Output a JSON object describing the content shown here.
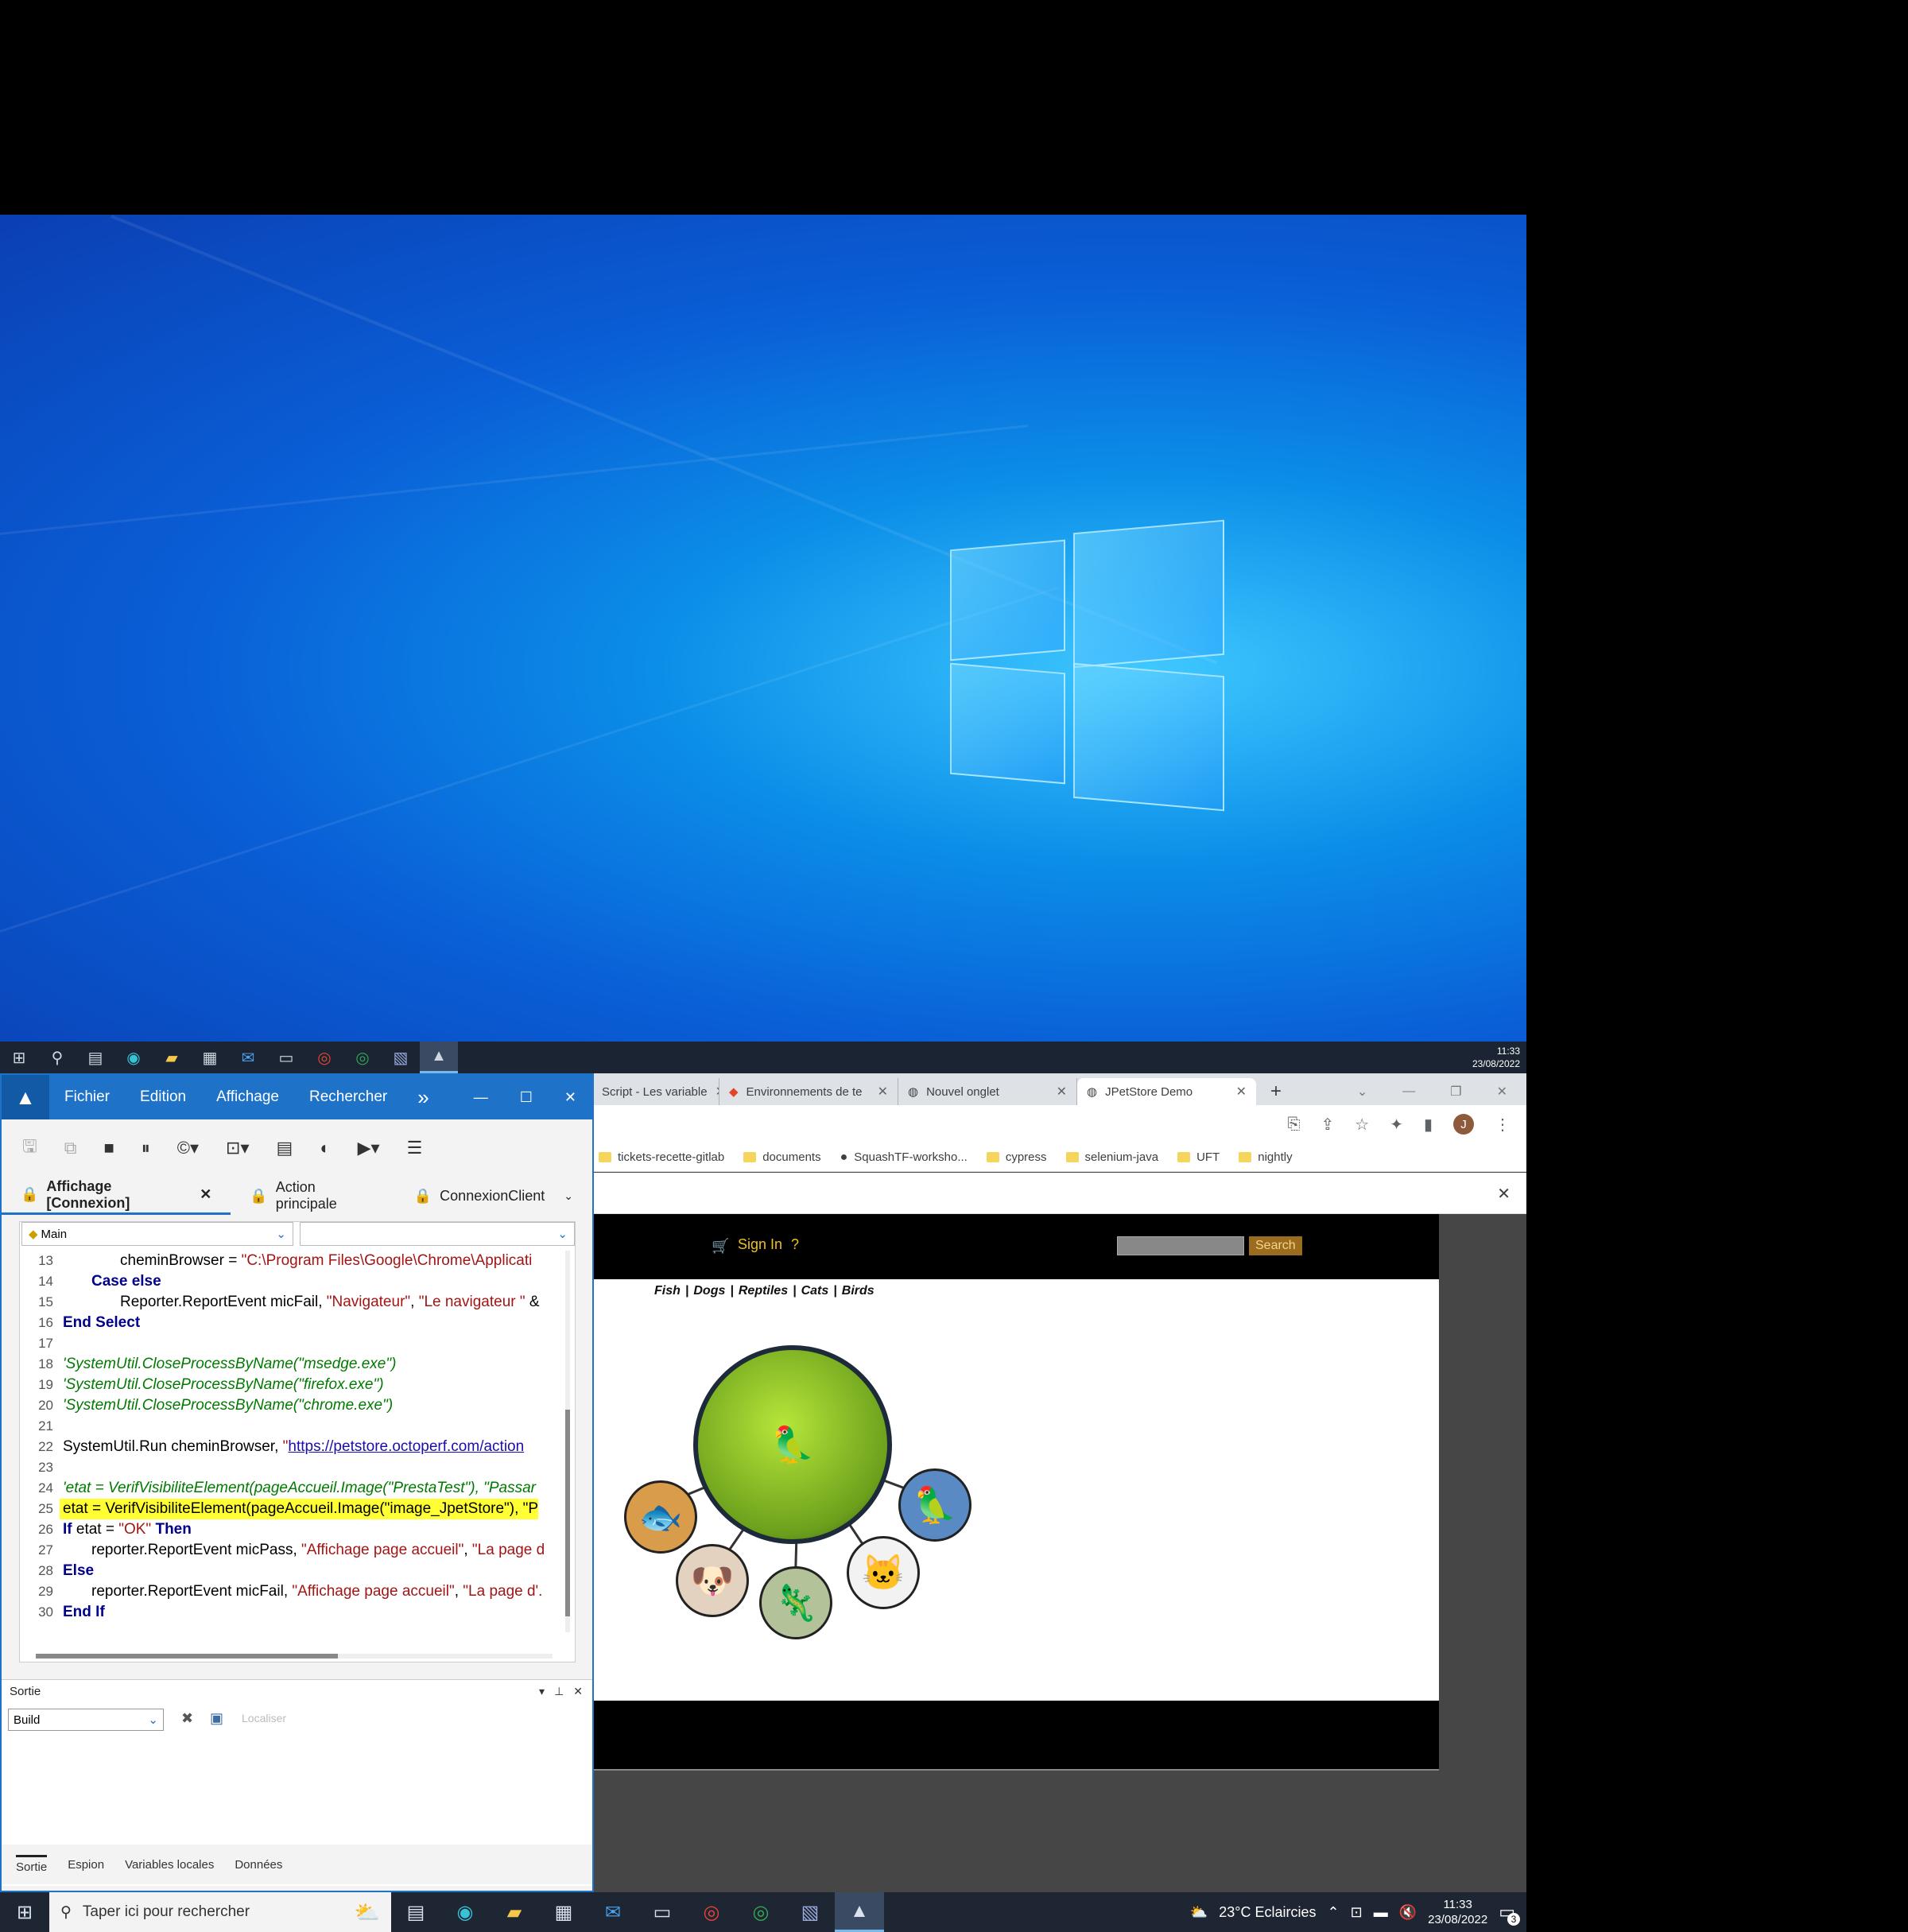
{
  "taskbar_top": {
    "time": "11:33",
    "date": "23/08/2022",
    "icons": [
      "windows-start-icon",
      "search-icon",
      "task-view-icon",
      "edge-icon",
      "explorer-icon",
      "store-icon",
      "mail-icon",
      "terminal-icon",
      "chrome-icon",
      "chrome-icon",
      "notepad-icon",
      "uft-icon"
    ]
  },
  "chrome": {
    "tabs": [
      {
        "label": "Script - Les variable",
        "active": false
      },
      {
        "label": "Environnements de te",
        "active": false
      },
      {
        "label": "Nouvel onglet",
        "active": false
      },
      {
        "label": "JPetStore Demo",
        "active": true
      }
    ],
    "new_tab": "+",
    "profile_initial": "J",
    "bookmarks": [
      "tickets-recette-gitlab",
      "documents",
      "SquashTF-worksho...",
      "cypress",
      "selenium-java",
      "UFT",
      "nightly"
    ],
    "infobar_close": "✕",
    "page": {
      "sign_in": "Sign In",
      "help": "?",
      "search_button": "Search",
      "categories": [
        "Fish",
        "Dogs",
        "Reptiles",
        "Cats",
        "Birds"
      ]
    }
  },
  "uft": {
    "menus": [
      "Fichier",
      "Edition",
      "Affichage",
      "Rechercher"
    ],
    "more": "»",
    "tabs": [
      {
        "label": "Affichage [Connexion]",
        "active": true,
        "closable": true
      },
      {
        "label": "Action principale",
        "active": false
      },
      {
        "label": "ConnexionClient",
        "active": false
      }
    ],
    "scope_combo": "Main",
    "code_lines": [
      {
        "n": "13",
        "indent": 2,
        "parts": [
          [
            "t",
            "cheminBrowser = "
          ],
          [
            "s",
            "\"C:\\Program Files\\Google\\Chrome\\Applicati"
          ]
        ]
      },
      {
        "n": "14",
        "indent": 1,
        "parts": [
          [
            "k",
            "Case else"
          ]
        ]
      },
      {
        "n": "15",
        "indent": 2,
        "parts": [
          [
            "t",
            "Reporter.ReportEvent micFail, "
          ],
          [
            "s",
            "\"Navigateur\""
          ],
          [
            "t",
            ", "
          ],
          [
            "s",
            "\"Le navigateur \""
          ],
          [
            "t",
            " &"
          ]
        ]
      },
      {
        "n": "16",
        "indent": 0,
        "parts": [
          [
            "k",
            "End Select"
          ]
        ]
      },
      {
        "n": "17",
        "indent": 0,
        "parts": []
      },
      {
        "n": "18",
        "indent": 0,
        "parts": [
          [
            "c",
            "'SystemUtil.CloseProcessByName(\"msedge.exe\")"
          ]
        ]
      },
      {
        "n": "19",
        "indent": 0,
        "parts": [
          [
            "c",
            "'SystemUtil.CloseProcessByName(\"firefox.exe\")"
          ]
        ]
      },
      {
        "n": "20",
        "indent": 0,
        "parts": [
          [
            "c",
            "'SystemUtil.CloseProcessByName(\"chrome.exe\")"
          ]
        ]
      },
      {
        "n": "21",
        "indent": 0,
        "parts": []
      },
      {
        "n": "22",
        "indent": 0,
        "parts": [
          [
            "t",
            "SystemUtil.Run cheminBrowser, "
          ],
          [
            "s",
            "\""
          ],
          [
            "u",
            "https://petstore.octoperf.com/action"
          ]
        ]
      },
      {
        "n": "23",
        "indent": 0,
        "parts": []
      },
      {
        "n": "24",
        "indent": 0,
        "parts": [
          [
            "c",
            "'etat = VerifVisibiliteElement(pageAccueil.Image(\"PrestaTest\"), \"Passar"
          ]
        ]
      },
      {
        "n": "25",
        "indent": 0,
        "hl": true,
        "parts": [
          [
            "t",
            "etat = VerifVisibiliteElement(pageAccueil.Image(\"image_JpetStore\"), \"P"
          ]
        ]
      },
      {
        "n": "26",
        "indent": 0,
        "parts": [
          [
            "k",
            "If"
          ],
          [
            "t",
            " etat = "
          ],
          [
            "s",
            "\"OK\""
          ],
          [
            "t",
            " "
          ],
          [
            "k",
            "Then"
          ]
        ]
      },
      {
        "n": "27",
        "indent": 1,
        "parts": [
          [
            "t",
            "reporter.ReportEvent micPass, "
          ],
          [
            "s",
            "\"Affichage page accueil\""
          ],
          [
            "t",
            ", "
          ],
          [
            "s",
            "\"La page d"
          ]
        ]
      },
      {
        "n": "28",
        "indent": 0,
        "parts": [
          [
            "k",
            "Else"
          ]
        ]
      },
      {
        "n": "29",
        "indent": 1,
        "parts": [
          [
            "t",
            "reporter.ReportEvent micFail, "
          ],
          [
            "s",
            "\"Affichage page accueil\""
          ],
          [
            "t",
            ", "
          ],
          [
            "s",
            "\"La page d'."
          ]
        ]
      },
      {
        "n": "30",
        "indent": 0,
        "parts": [
          [
            "k",
            "End If"
          ]
        ]
      }
    ],
    "output_title": "Sortie",
    "output_combo": "Build",
    "locate_label": "Localiser",
    "bottom_tabs": [
      "Sortie",
      "Espion",
      "Variables locales",
      "Données"
    ]
  },
  "taskbar_bottom": {
    "search_placeholder": "Taper ici pour rechercher",
    "weather": "23°C  Eclaircies",
    "time": "11:33",
    "date": "23/08/2022",
    "notification_count": "3"
  }
}
